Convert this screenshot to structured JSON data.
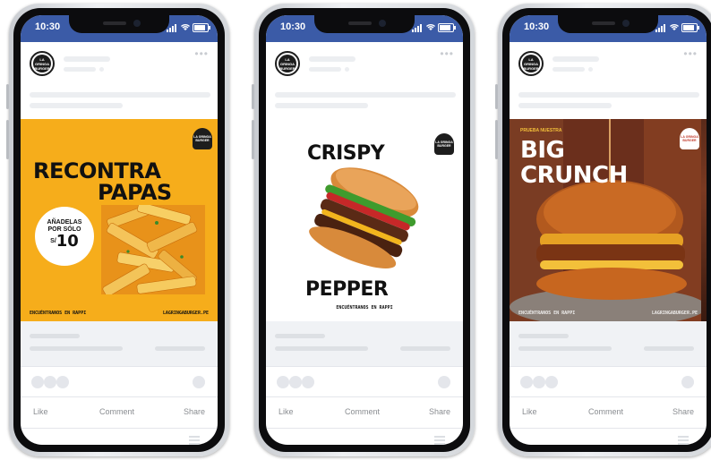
{
  "phones": [
    {
      "status": {
        "time": "10:30"
      },
      "ad": {
        "brand": "LA GRINGA BURGER",
        "headline_1": "RECONTRA",
        "headline_2": "PAPAS",
        "promo_line_1": "AÑADELAS",
        "promo_line_2": "POR SÓLO",
        "currency": "S/",
        "price": "10",
        "footer_left": "ENCUÉNTRANOS EN RAPPI",
        "footer_right": "LAGRINGABURGER.PE"
      },
      "actions": {
        "like": "Like",
        "comment": "Comment",
        "share": "Share"
      }
    },
    {
      "status": {
        "time": "10:30"
      },
      "ad": {
        "brand": "LA GRINGA BURGER",
        "headline_1": "CRISPY",
        "headline_2": "PEPPER",
        "footer": "ENCUÉNTRANOS EN RAPPI"
      },
      "actions": {
        "like": "Like",
        "comment": "Comment",
        "share": "Share"
      }
    },
    {
      "status": {
        "time": "10:30"
      },
      "ad": {
        "brand": "LA GRINGA BURGER",
        "eyebrow": "PRUEBA NUESTRA",
        "headline_1": "BIG",
        "headline_2": "CRUNCH",
        "footer_left": "ENCUÉNTRANOS EN RAPPI",
        "footer_right": "LAGRINGABURGER.PE"
      },
      "actions": {
        "like": "Like",
        "comment": "Comment",
        "share": "Share"
      }
    }
  ],
  "colors": {
    "status_bar": "#3b5ba7",
    "ad_yellow": "#f6ad1b",
    "placeholder": "#eceef1",
    "action_text": "#8a8d91"
  }
}
